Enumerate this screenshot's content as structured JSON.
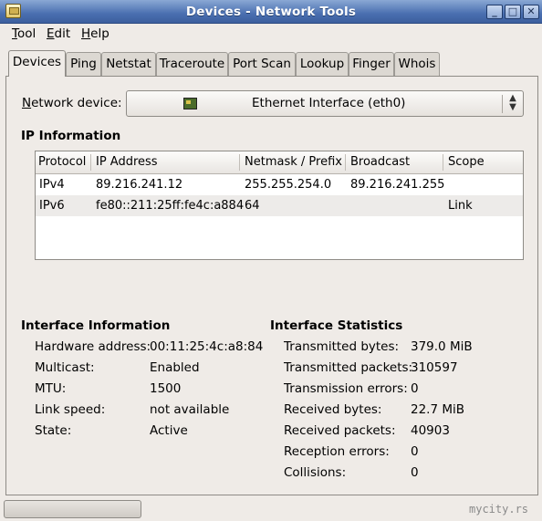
{
  "window": {
    "title": "Devices - Network Tools",
    "minimize": "_",
    "maximize": "□",
    "close": "✕"
  },
  "menu": {
    "items": [
      {
        "key": "T",
        "rest": "ool"
      },
      {
        "key": "E",
        "rest": "dit"
      },
      {
        "key": "H",
        "rest": "elp"
      }
    ]
  },
  "tabs": [
    "Devices",
    "Ping",
    "Netstat",
    "Traceroute",
    "Port Scan",
    "Lookup",
    "Finger",
    "Whois"
  ],
  "device": {
    "label_key": "N",
    "label_rest": "etwork device:",
    "value": "Ethernet Interface (eth0)",
    "icon": "network-card-icon"
  },
  "ip_info": {
    "title": "IP Information",
    "columns": [
      "Protocol",
      "IP Address",
      "Netmask / Prefix",
      "Broadcast",
      "Scope"
    ],
    "rows": [
      [
        "IPv4",
        "89.216.241.12",
        "255.255.254.0",
        "89.216.241.255",
        ""
      ],
      [
        "IPv6",
        "fe80::211:25ff:fe4c:a884",
        "64",
        "",
        "Link"
      ]
    ]
  },
  "interface_info": {
    "title": "Interface Information",
    "items": [
      {
        "label": "Hardware address:",
        "value": "00:11:25:4c:a8:84"
      },
      {
        "label": "Multicast:",
        "value": "Enabled"
      },
      {
        "label": "MTU:",
        "value": "1500"
      },
      {
        "label": "Link speed:",
        "value": "not available"
      },
      {
        "label": "State:",
        "value": "Active"
      }
    ]
  },
  "interface_stats": {
    "title": "Interface Statistics",
    "items": [
      {
        "label": "Transmitted bytes:",
        "value": "379.0 MiB"
      },
      {
        "label": "Transmitted packets:",
        "value": "310597"
      },
      {
        "label": "Transmission errors:",
        "value": "0"
      },
      {
        "label": "Received bytes:",
        "value": "22.7 MiB"
      },
      {
        "label": "Received packets:",
        "value": "40903"
      },
      {
        "label": "Reception errors:",
        "value": "0"
      },
      {
        "label": "Collisions:",
        "value": "0"
      }
    ]
  },
  "watermark": "mycity.rs",
  "colors": {
    "titlebar": "#4a6fb0",
    "window_bg": "#efebe7",
    "table_alt_row": "#edebe9"
  }
}
